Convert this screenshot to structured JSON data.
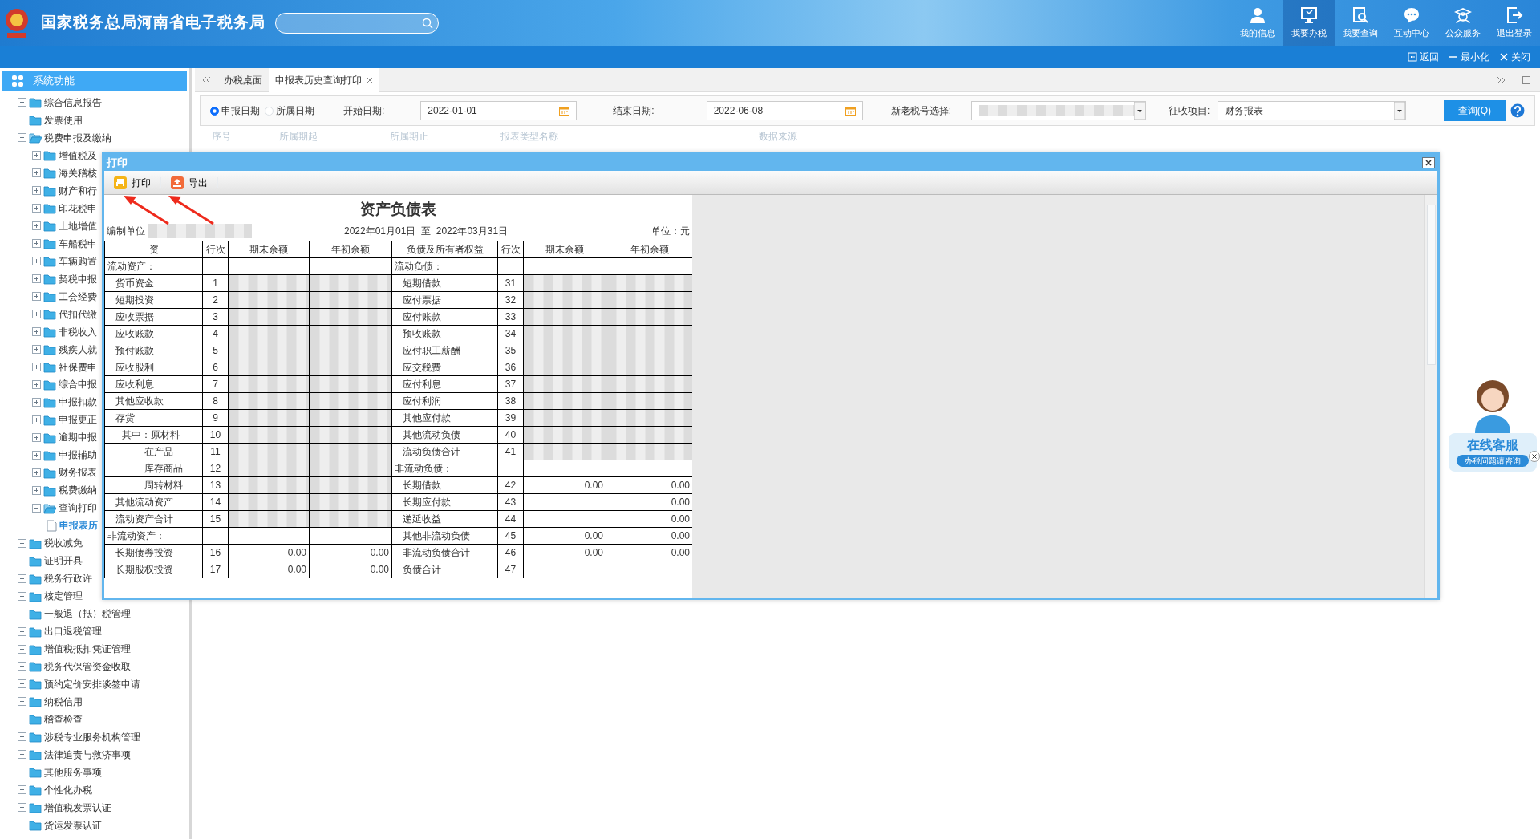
{
  "header": {
    "title": "国家税务总局河南省电子税务局",
    "nav": [
      {
        "label": "我的信息",
        "kind": "user",
        "selected": false
      },
      {
        "label": "我要办税",
        "kind": "desk",
        "selected": true
      },
      {
        "label": "我要查询",
        "kind": "query",
        "selected": false
      },
      {
        "label": "互动中心",
        "kind": "chat",
        "selected": false
      },
      {
        "label": "公众服务",
        "kind": "public",
        "selected": false
      },
      {
        "label": "退出登录",
        "kind": "logout",
        "selected": false
      }
    ]
  },
  "window_bar": {
    "actions": [
      {
        "label": "返回",
        "kind": "back"
      },
      {
        "label": "最小化",
        "kind": "min"
      },
      {
        "label": "关闭",
        "kind": "close"
      }
    ]
  },
  "sidebar": {
    "title": "系统功能",
    "items": [
      {
        "label": "综合信息报告",
        "expanded": false
      },
      {
        "label": "发票使用",
        "expanded": false
      },
      {
        "label": "税费申报及缴纳",
        "expanded": true,
        "children": [
          {
            "label": "增值税及",
            "expanded": false
          },
          {
            "label": "海关稽核",
            "expanded": false
          },
          {
            "label": "财产和行",
            "expanded": false
          },
          {
            "label": "印花税申",
            "expanded": false
          },
          {
            "label": "土地增值",
            "expanded": false
          },
          {
            "label": "车船税申",
            "expanded": false
          },
          {
            "label": "车辆购置",
            "expanded": false
          },
          {
            "label": "契税申报",
            "expanded": false
          },
          {
            "label": "工会经费",
            "expanded": false
          },
          {
            "label": "代扣代缴",
            "expanded": false
          },
          {
            "label": "非税收入",
            "expanded": false
          },
          {
            "label": "残疾人就",
            "expanded": false
          },
          {
            "label": "社保费申",
            "expanded": false
          },
          {
            "label": "综合申报",
            "expanded": false
          },
          {
            "label": "申报扣款",
            "expanded": false
          },
          {
            "label": "申报更正",
            "expanded": false
          },
          {
            "label": "逾期申报",
            "expanded": false
          },
          {
            "label": "申报辅助",
            "expanded": false
          },
          {
            "label": "财务报表",
            "expanded": false
          },
          {
            "label": "税费缴纳",
            "expanded": false
          },
          {
            "label": "查询打印",
            "expanded": true,
            "children": [
              {
                "label": "申报表历",
                "selected": true
              }
            ]
          }
        ]
      },
      {
        "label": "税收减免",
        "expanded": false
      },
      {
        "label": "证明开具",
        "expanded": false
      },
      {
        "label": "税务行政许",
        "expanded": false
      },
      {
        "label": "核定管理",
        "expanded": false
      },
      {
        "label": "一般退（抵）税管理",
        "expanded": false
      },
      {
        "label": "出口退税管理",
        "expanded": false
      },
      {
        "label": "增值税抵扣凭证管理",
        "expanded": false
      },
      {
        "label": "税务代保管资金收取",
        "expanded": false
      },
      {
        "label": "预约定价安排谈签申请",
        "expanded": false
      },
      {
        "label": "纳税信用",
        "expanded": false
      },
      {
        "label": "稽查检查",
        "expanded": false
      },
      {
        "label": "涉税专业服务机构管理",
        "expanded": false
      },
      {
        "label": "法律追责与救济事项",
        "expanded": false
      },
      {
        "label": "其他服务事项",
        "expanded": false
      },
      {
        "label": "个性化办税",
        "expanded": false
      },
      {
        "label": "增值税发票认证",
        "expanded": false
      },
      {
        "label": "货运发票认证",
        "expanded": false
      }
    ]
  },
  "tabs": [
    {
      "label": "办税桌面",
      "selected": false,
      "closable": false
    },
    {
      "label": "申报表历史查询打印",
      "selected": true,
      "closable": true
    }
  ],
  "filter": {
    "date_types": [
      {
        "label": "申报日期",
        "selected": true
      },
      {
        "label": "所属日期",
        "selected": false
      }
    ],
    "start_label": "开始日期:",
    "start_value": "2022-01-01",
    "end_label": "结束日期:",
    "end_value": "2022-06-08",
    "taxno_label": "新老税号选择:",
    "item_label": "征收项目:",
    "item_value": "财务报表",
    "query_button": "查询(Q)"
  },
  "grid": {
    "columns": [
      "序号",
      "所属期起",
      "所属期止",
      "报表类型名称",
      "数据来源"
    ]
  },
  "dialog": {
    "title": "打印",
    "toolbar": [
      {
        "label": "打印",
        "kind": "print"
      },
      {
        "label": "导出",
        "kind": "export"
      }
    ],
    "annotations": [
      {
        "kind": "arrow"
      },
      {
        "kind": "arrow"
      }
    ],
    "report": {
      "title": "资产负债表",
      "unit_label": "编制单位",
      "period": "2022年01月01日  至  2022年03月31日",
      "unit": "单位：元",
      "columns": [
        "资",
        "行次",
        "期末余额",
        "年初余额",
        "负债及所有者权益",
        "行次",
        "期末余额",
        "年初余额"
      ],
      "rows": [
        {
          "left": {
            "name": "流动资产：",
            "kind": "section"
          },
          "right": {
            "name": "流动负债：",
            "kind": "section"
          }
        },
        {
          "left": {
            "name": "货币资金",
            "kind": "item",
            "line": "1",
            "masked": true
          },
          "right": {
            "name": "短期借款",
            "kind": "item",
            "line": "31",
            "masked": true
          }
        },
        {
          "left": {
            "name": "短期投资",
            "kind": "item",
            "line": "2",
            "masked": true
          },
          "right": {
            "name": "应付票据",
            "kind": "item",
            "line": "32",
            "masked": true
          }
        },
        {
          "left": {
            "name": "应收票据",
            "kind": "item",
            "line": "3",
            "masked": true
          },
          "right": {
            "name": "应付账款",
            "kind": "item",
            "line": "33",
            "masked": true
          }
        },
        {
          "left": {
            "name": "应收账款",
            "kind": "item",
            "line": "4",
            "masked": true
          },
          "right": {
            "name": "预收账款",
            "kind": "item",
            "line": "34",
            "masked": true
          }
        },
        {
          "left": {
            "name": "预付账款",
            "kind": "item",
            "line": "5",
            "masked": true
          },
          "right": {
            "name": "应付职工薪酬",
            "kind": "item",
            "line": "35",
            "masked": true
          }
        },
        {
          "left": {
            "name": "应收股利",
            "kind": "item",
            "line": "6",
            "masked": true
          },
          "right": {
            "name": "应交税费",
            "kind": "item",
            "line": "36",
            "masked": true
          }
        },
        {
          "left": {
            "name": "应收利息",
            "kind": "item",
            "line": "7",
            "masked": true
          },
          "right": {
            "name": "应付利息",
            "kind": "item",
            "line": "37",
            "masked": true
          }
        },
        {
          "left": {
            "name": "其他应收款",
            "kind": "item",
            "line": "8",
            "masked": true
          },
          "right": {
            "name": "应付利润",
            "kind": "item",
            "line": "38",
            "masked": true
          }
        },
        {
          "left": {
            "name": "存货",
            "kind": "item",
            "line": "9",
            "masked": true
          },
          "right": {
            "name": "其他应付款",
            "kind": "item",
            "line": "39",
            "masked": true
          }
        },
        {
          "left": {
            "name": "其中：原材料",
            "kind": "sublead",
            "line": "10",
            "masked": true
          },
          "right": {
            "name": "其他流动负债",
            "kind": "item",
            "line": "40",
            "masked": true
          }
        },
        {
          "left": {
            "name": "在产品",
            "kind": "sub",
            "line": "11",
            "masked": true
          },
          "right": {
            "name": "流动负债合计",
            "kind": "item",
            "line": "41",
            "masked": true
          }
        },
        {
          "left": {
            "name": "库存商品",
            "kind": "sub",
            "line": "12",
            "masked": true
          },
          "right": {
            "name": "非流动负债：",
            "kind": "section"
          }
        },
        {
          "left": {
            "name": "周转材料",
            "kind": "sub",
            "line": "13",
            "masked": true
          },
          "right": {
            "name": "长期借款",
            "kind": "item",
            "line": "42",
            "end": "0.00",
            "start": "0.00"
          }
        },
        {
          "left": {
            "name": "其他流动资产",
            "kind": "item",
            "line": "14",
            "masked": true
          },
          "right": {
            "name": "长期应付款",
            "kind": "item",
            "line": "43",
            "start": "0.00"
          }
        },
        {
          "left": {
            "name": "流动资产合计",
            "kind": "item",
            "line": "15",
            "masked": true
          },
          "right": {
            "name": "递延收益",
            "kind": "item",
            "line": "44",
            "start": "0.00"
          }
        },
        {
          "left": {
            "name": "非流动资产：",
            "kind": "section"
          },
          "right": {
            "name": "其他非流动负债",
            "kind": "item",
            "line": "45",
            "end": "0.00",
            "start": "0.00"
          }
        },
        {
          "left": {
            "name": "长期债券投资",
            "kind": "item",
            "line": "16",
            "end": "0.00",
            "start": "0.00"
          },
          "right": {
            "name": "非流动负债合计",
            "kind": "item",
            "line": "46",
            "end": "0.00",
            "start": "0.00"
          }
        },
        {
          "left": {
            "name": "长期股权投资",
            "kind": "item",
            "line": "17",
            "end": "0.00",
            "start": "0.00"
          },
          "right": {
            "name": "负债合计",
            "kind": "item",
            "line": "47"
          }
        }
      ]
    }
  },
  "support": {
    "title": "在线客服",
    "subtitle": "办税问题请咨询"
  }
}
